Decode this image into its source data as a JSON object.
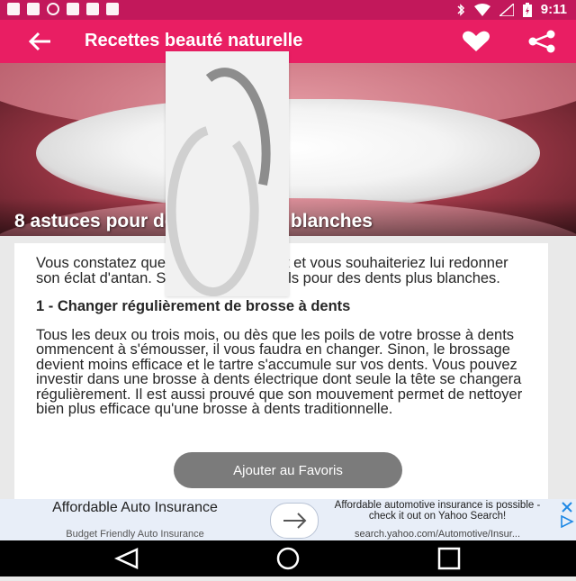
{
  "status_bar": {
    "time": "9:11",
    "icons": [
      "facebook-icon",
      "facebook-icon",
      "alarm-icon",
      "game-icon",
      "lock-icon",
      "android-icon",
      "bluetooth-icon",
      "wifi-icon",
      "no-signal-icon",
      "battery-charging-icon"
    ]
  },
  "app_bar": {
    "title": "Recettes beauté naturelle",
    "back_icon": "arrow-back-icon",
    "favorite_icon": "heart-icon",
    "share_icon": "share-icon"
  },
  "hero": {
    "caption": "8 astuces pour des dents plus blanches"
  },
  "article": {
    "intro": "Vous constatez que votre sourire ternit et vous souhaiteriez lui redonner son éclat d'antan. Suivez nos 8 conseils pour des dents plus blanches.",
    "heading_1": "1 - Changer régulièrement de brosse à dents",
    "paragraph_1": "Tous les deux ou trois mois, ou dès que les poils de votre brosse à dents ommencent à s'émousser, il vous faudra en changer. Sinon, le brossage devient moins efficace et le tartre s'accumule sur vos dents. Vous pouvez investir dans une brosse à dents électrique dont seule la tête se changera régulièrement. Il est aussi prouvé que son mouvement permet de nettoyer bien plus efficace qu'une brosse à dents traditionnelle."
  },
  "snackbar": {
    "label": "Ajouter au Favoris"
  },
  "ad": {
    "title": "Affordable Auto Insurance",
    "subtitle": "Budget Friendly Auto Insurance",
    "description": "Affordable automotive insurance is possible - check it out on Yahoo Search!",
    "url": "search.yahoo.com/Automotive/Insur...",
    "arrow_icon": "arrow-right-icon",
    "close_icon": "close-icon",
    "adchoices_icon": "adchoices-icon"
  },
  "colors": {
    "status_bar": "#c2185b",
    "app_bar": "#e91e63",
    "background": "#e9e9e9",
    "text": "#262626"
  }
}
